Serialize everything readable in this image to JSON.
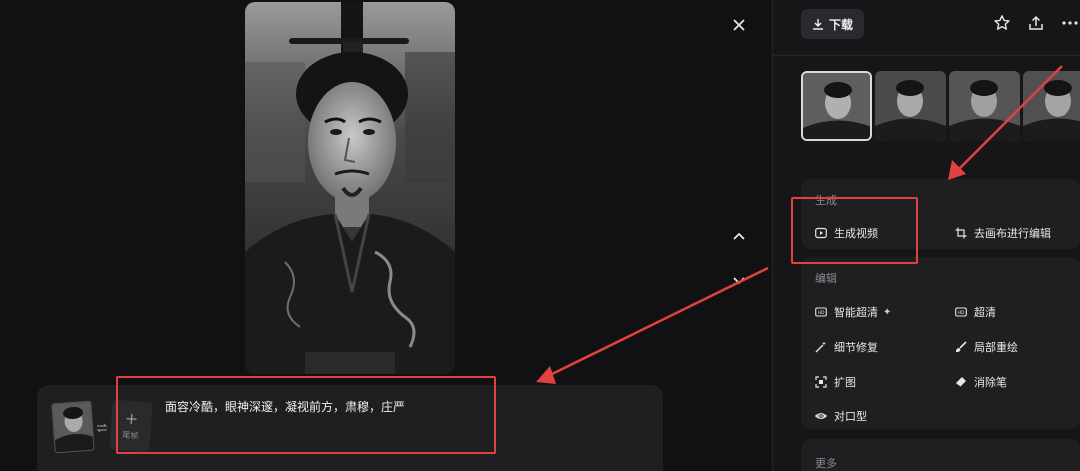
{
  "viewer": {
    "prompt_text": "面容冷酷，眼神深邃，凝视前方，肃穆，庄严",
    "ref_add_label": "尾帧",
    "icons": [
      "close-icon",
      "chevron-up-icon",
      "chevron-down-icon",
      "swap-icon",
      "plus-icon"
    ]
  },
  "toolbar": {
    "download_label": "下载",
    "icons": [
      "download-icon",
      "star-icon",
      "share-icon",
      "more-icon"
    ]
  },
  "generate_section": {
    "title": "生成",
    "items": [
      {
        "label": "生成视频",
        "icon": "play-video-icon"
      },
      {
        "label": "去画布进行编辑",
        "icon": "canvas-crop-icon"
      }
    ]
  },
  "edit_section": {
    "title": "编辑",
    "items": [
      {
        "label": "智能超清",
        "icon": "hd-smart-icon"
      },
      {
        "label": "超清",
        "icon": "hd-icon"
      },
      {
        "label": "细节修复",
        "icon": "magic-wand-icon"
      },
      {
        "label": "局部重绘",
        "icon": "brush-icon"
      },
      {
        "label": "扩图",
        "icon": "expand-icon"
      },
      {
        "label": "消除笔",
        "icon": "eraser-icon"
      },
      {
        "label": "对口型",
        "icon": "lips-icon"
      }
    ]
  },
  "more_section": {
    "title": "更多"
  },
  "colors": {
    "background": "#121214",
    "panel": "#161618",
    "card": "#1f1f22",
    "annotation_red": "#e0423f",
    "text": "#e8e8e8",
    "muted_text": "#8a8a8f"
  }
}
